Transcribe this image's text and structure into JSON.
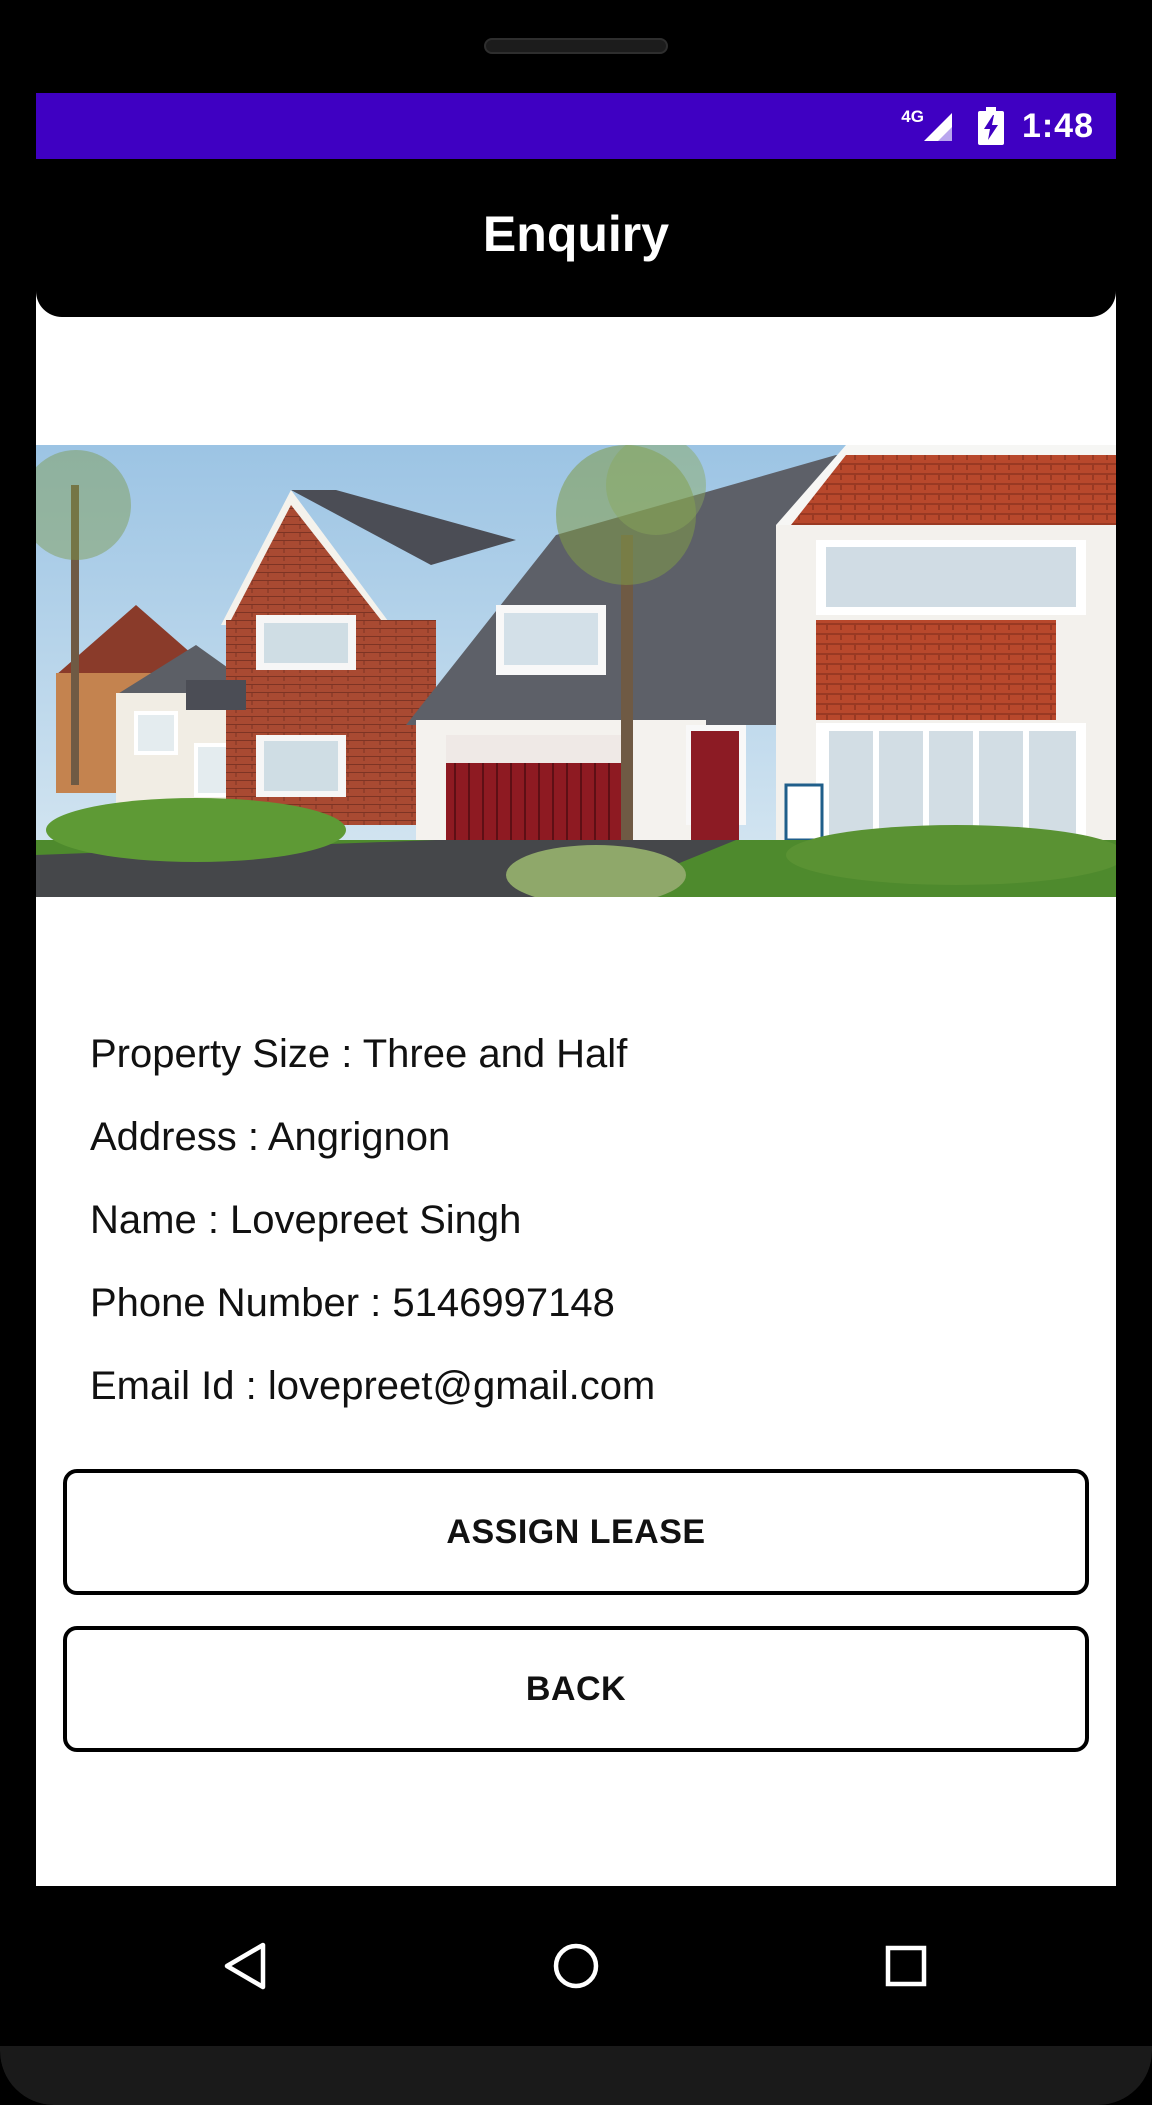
{
  "status_bar": {
    "network_type": "4G",
    "signal_icon": "signal-icon",
    "battery_icon": "battery-charging-icon",
    "time": "1:48",
    "background_color": "#3f00c2"
  },
  "app_bar": {
    "title": "Enquiry",
    "background_color": "#000000"
  },
  "hero_image": {
    "subject": "house-exterior-photo"
  },
  "details": [
    {
      "label": "Property Size",
      "value": "Three and Half",
      "text": "Property Size : Three and Half"
    },
    {
      "label": "Address",
      "value": "Angrignon",
      "text": "Address : Angrignon"
    },
    {
      "label": "Name",
      "value": "Lovepreet Singh",
      "text": "Name : Lovepreet Singh"
    },
    {
      "label": "Phone Number",
      "value": "5146997148",
      "text": "Phone Number : 5146997148"
    },
    {
      "label": "Email Id",
      "value": "lovepreet@gmail.com",
      "text": "Email Id : lovepreet@gmail.com"
    }
  ],
  "buttons": {
    "assign_lease": "ASSIGN LEASE",
    "back": "BACK"
  },
  "nav_bar": {
    "back_icon": "back-triangle-icon",
    "home_icon": "home-circle-icon",
    "recents_icon": "recents-square-icon"
  }
}
